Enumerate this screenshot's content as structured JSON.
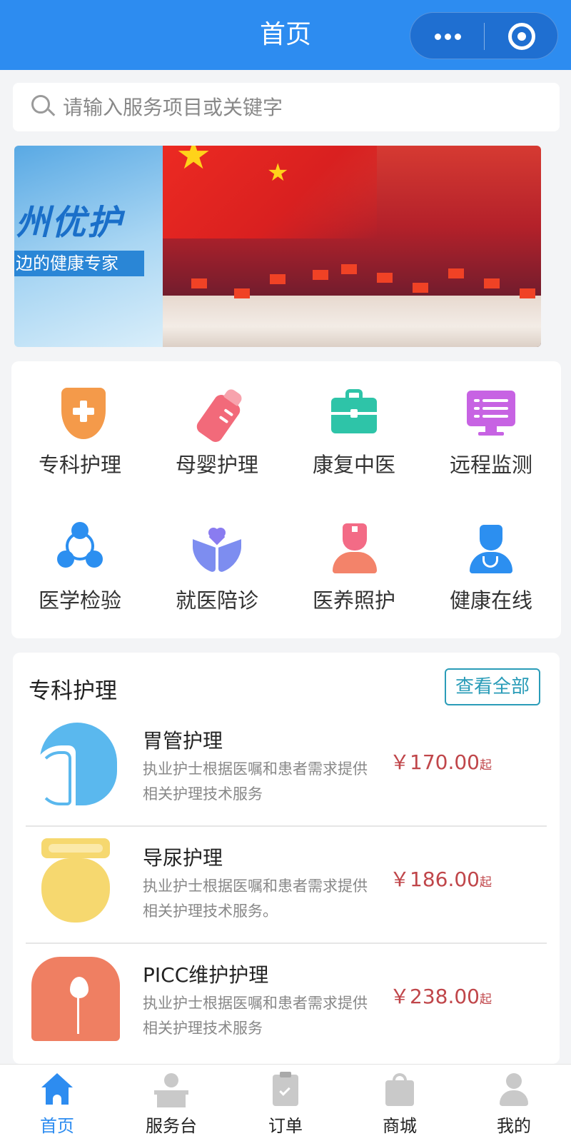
{
  "header": {
    "title": "首页",
    "more_icon": "more-dots-icon",
    "close_icon": "target-circle-icon",
    "color": "#2d8cf0"
  },
  "search": {
    "placeholder": "请输入服务项目或关键字",
    "icon": "search-icon"
  },
  "banner": {
    "left_slide_text": "州优护",
    "left_slide_tagline": "边的健康专家"
  },
  "categories": [
    {
      "label": "专科护理",
      "icon": "shield-plus-icon",
      "color": "#f49a4a"
    },
    {
      "label": "母婴护理",
      "icon": "baby-bottle-icon",
      "color": "#f26a7a"
    },
    {
      "label": "康复中医",
      "icon": "medical-bag-icon",
      "color": "#2ec4a8"
    },
    {
      "label": "远程监测",
      "icon": "monitor-icon",
      "color": "#c763e3"
    },
    {
      "label": "医学检验",
      "icon": "network-nodes-icon",
      "color": "#2c8ff0"
    },
    {
      "label": "就医陪诊",
      "icon": "hands-heart-icon",
      "color": "#7d8df0"
    },
    {
      "label": "医养照护",
      "icon": "nurse-icon",
      "color": "#f36b86"
    },
    {
      "label": "健康在线",
      "icon": "doctor-icon",
      "color": "#2c8ff0"
    }
  ],
  "specialty": {
    "title": "专科护理",
    "view_all": "查看全部",
    "items": [
      {
        "name": "胃管护理",
        "desc_line1": "执业护士根据医嘱和患者需求提供",
        "desc_line2": "相关护理技术服务",
        "price": "￥170.00",
        "suffix": "起"
      },
      {
        "name": "导尿护理",
        "desc_line1": "执业护士根据医嘱和患者需求提供",
        "desc_line2": "相关护理技术服务。",
        "price": "￥186.00",
        "suffix": "起"
      },
      {
        "name": "PICC维护护理",
        "desc_line1": "执业护士根据医嘱和患者需求提供",
        "desc_line2": "相关护理技术服务",
        "price": "￥238.00",
        "suffix": "起"
      }
    ],
    "price_color": "#c0464a"
  },
  "tabbar": {
    "tabs": [
      {
        "label": "首页",
        "icon": "home-icon",
        "active": true
      },
      {
        "label": "服务台",
        "icon": "service-desk-icon",
        "active": false
      },
      {
        "label": "订单",
        "icon": "clipboard-check-icon",
        "active": false
      },
      {
        "label": "商城",
        "icon": "shopping-bag-icon",
        "active": false
      },
      {
        "label": "我的",
        "icon": "user-icon",
        "active": false
      }
    ],
    "active_color": "#2d8cf0"
  }
}
